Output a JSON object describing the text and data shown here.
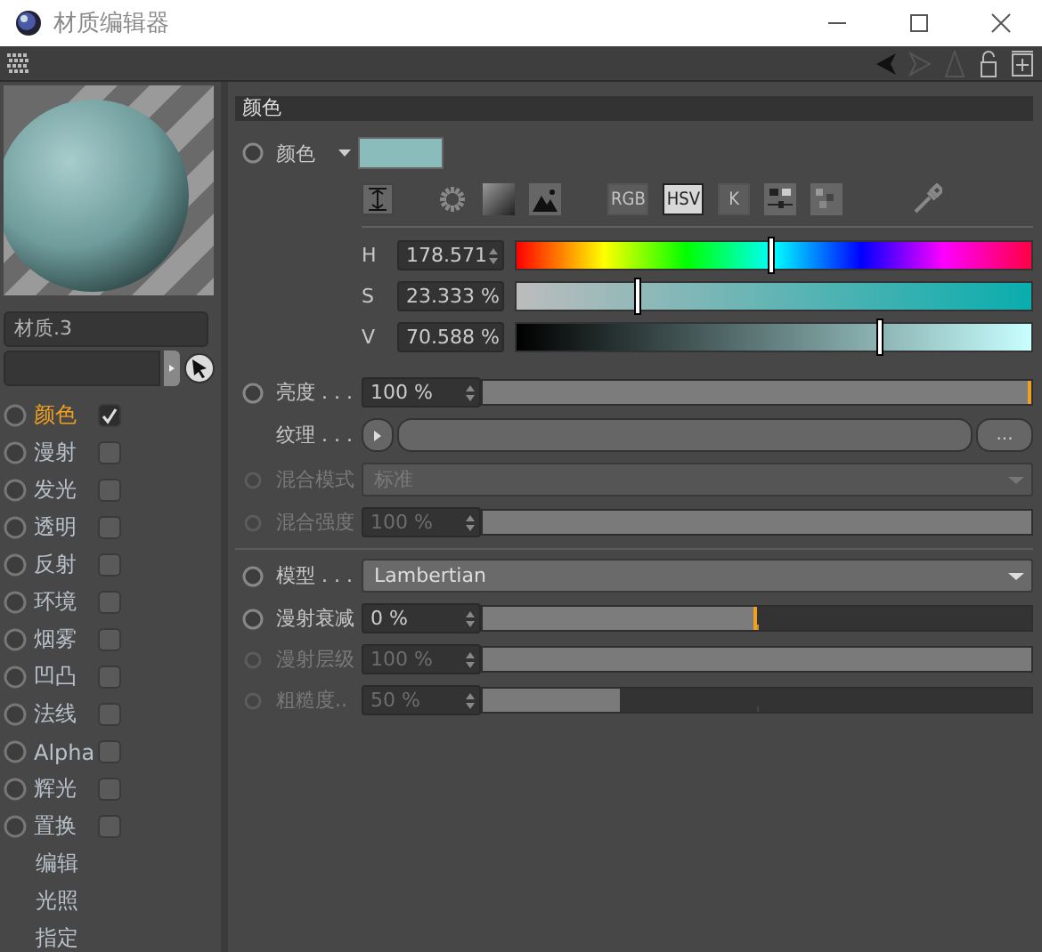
{
  "window": {
    "title": "材质编辑器"
  },
  "material": {
    "name": "材质.3"
  },
  "channels": [
    {
      "label": "颜色",
      "selected": true,
      "checked": true
    },
    {
      "label": "漫射",
      "selected": false,
      "checked": false
    },
    {
      "label": "发光",
      "selected": false,
      "checked": false
    },
    {
      "label": "透明",
      "selected": false,
      "checked": false
    },
    {
      "label": "反射",
      "selected": false,
      "checked": false
    },
    {
      "label": "环境",
      "selected": false,
      "checked": false
    },
    {
      "label": "烟雾",
      "selected": false,
      "checked": false
    },
    {
      "label": "凹凸",
      "selected": false,
      "checked": false
    },
    {
      "label": "法线",
      "selected": false,
      "checked": false
    },
    {
      "label": "Alpha",
      "selected": false,
      "checked": false
    },
    {
      "label": "辉光",
      "selected": false,
      "checked": false
    },
    {
      "label": "置换",
      "selected": false,
      "checked": false
    }
  ],
  "pages": [
    "编辑",
    "光照",
    "指定"
  ],
  "section": {
    "title": "颜色"
  },
  "color": {
    "label": "颜色",
    "color": "#8bbcbc",
    "modes": [
      {
        "label": "RGB",
        "selected": false
      },
      {
        "label": "HSV",
        "selected": true
      },
      {
        "label": "K",
        "selected": false
      }
    ],
    "sliders": [
      {
        "kind": "hue",
        "label": "H",
        "value": "178.571",
        "level": 0.496
      },
      {
        "kind": "saturation",
        "label": "S",
        "value": "23.333 %",
        "level": 0.236
      },
      {
        "kind": "value",
        "label": "V",
        "value": "70.588 %",
        "level": 0.706
      }
    ]
  },
  "params": [
    {
      "kind": "slider",
      "label": "亮度 . . .",
      "value": "100 %",
      "level": 1,
      "disabled": false
    },
    {
      "kind": "texture",
      "label": "纹理 . . .",
      "button": "..."
    },
    {
      "kind": "dropdown",
      "label": "混合模式",
      "value": "标准",
      "disabled": true
    },
    {
      "kind": "slider",
      "label": "混合强度",
      "value": "100 %",
      "level": 1,
      "disabled": true
    },
    {
      "kind": "separator"
    },
    {
      "kind": "dropdown",
      "label": "模型 . . .",
      "value": "Lambertian",
      "disabled": false
    },
    {
      "kind": "slider",
      "label": "漫射衰减",
      "value": "0 %",
      "level": 0.5,
      "disabled": false
    },
    {
      "kind": "slider",
      "label": "漫射层级",
      "value": "100 %",
      "level": 1,
      "disabled": true
    },
    {
      "kind": "slider",
      "label": "粗糙度..",
      "value": "50 %",
      "level": 0.25,
      "disabled": true
    }
  ]
}
